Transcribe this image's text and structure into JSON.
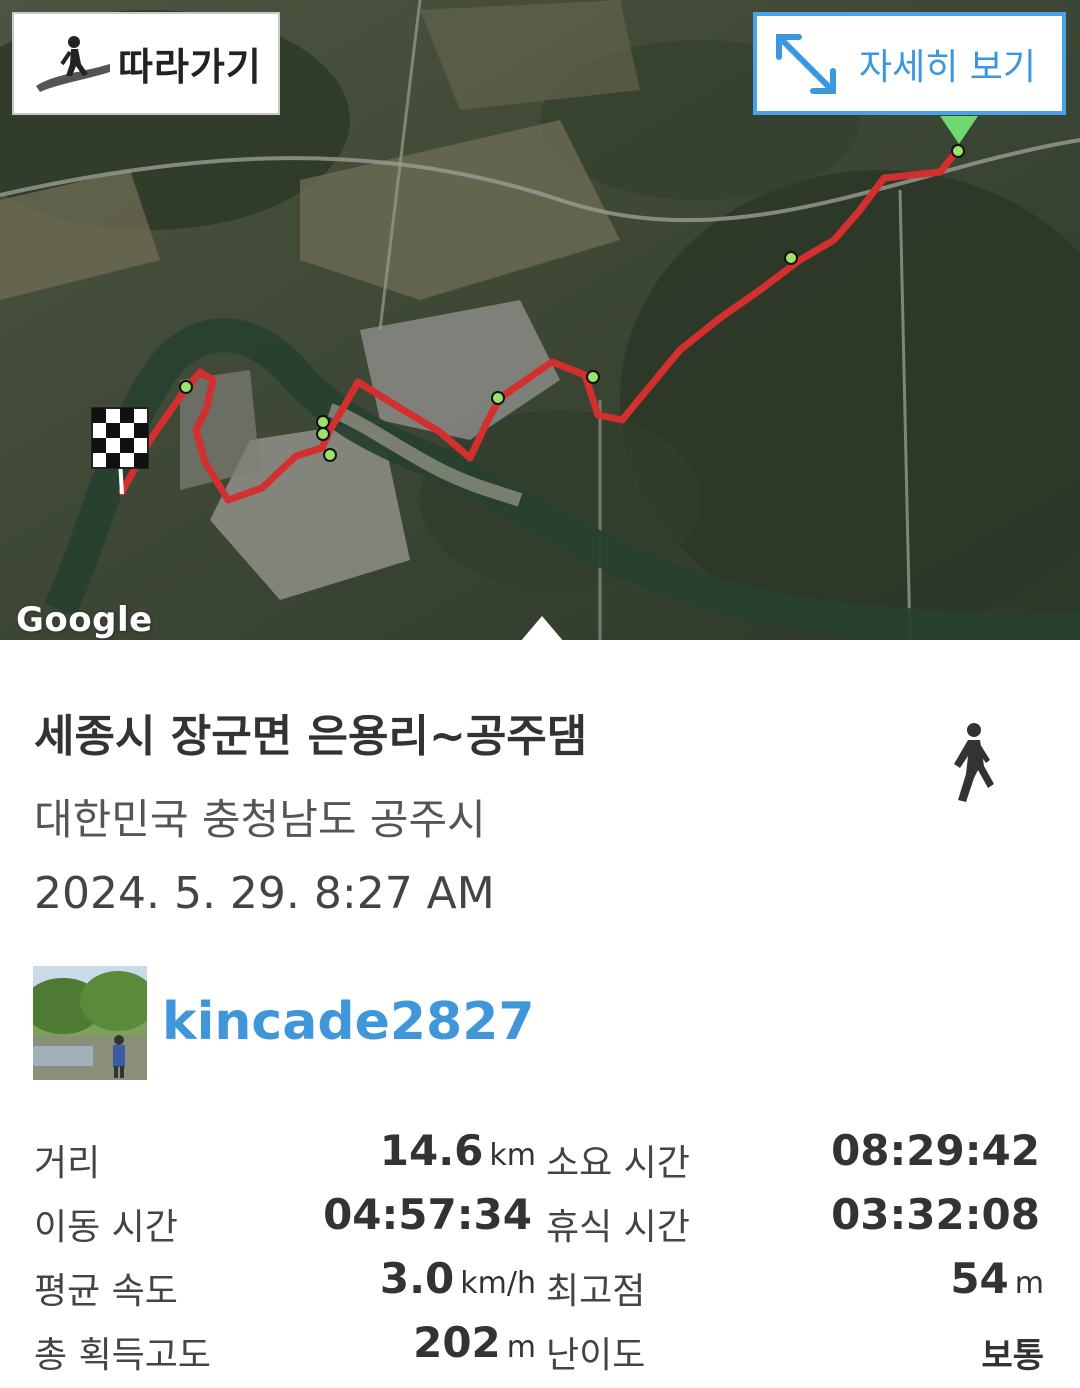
{
  "map": {
    "follow_button_label": "따라가기",
    "detail_button_label": "자세히 보기",
    "attribution": "Google",
    "route_color": "#d32f2f",
    "waypoint_color": "#9be36a",
    "start_marker": "checkered-flag-icon",
    "end_marker": "green-triangle-icon"
  },
  "track": {
    "title": "세종시 장군면 은용리~공주댐",
    "location": "대한민국 충청남도 공주시",
    "datetime": "2024. 5. 29. 8:27 AM",
    "activity_icon": "walking-person-icon",
    "username": "kincade2827"
  },
  "stats": {
    "distance_label": "거리",
    "distance_value": "14.6",
    "distance_unit": "km",
    "duration_label": "소요 시간",
    "duration_value": "08:29:42",
    "moving_label": "이동 시간",
    "moving_value": "04:57:34",
    "rest_label": "휴식 시간",
    "rest_value": "03:32:08",
    "speed_label": "평균 속도",
    "speed_value": "3.0",
    "speed_unit": "km/h",
    "max_alt_label": "최고점",
    "max_alt_value": "54",
    "max_alt_unit": "m",
    "gain_label": "총 획득고도",
    "gain_value": "202",
    "gain_unit": "m",
    "difficulty_label": "난이도",
    "difficulty_value": "보통"
  },
  "colors": {
    "accent": "#3f97d9",
    "text_dark": "#333333"
  }
}
